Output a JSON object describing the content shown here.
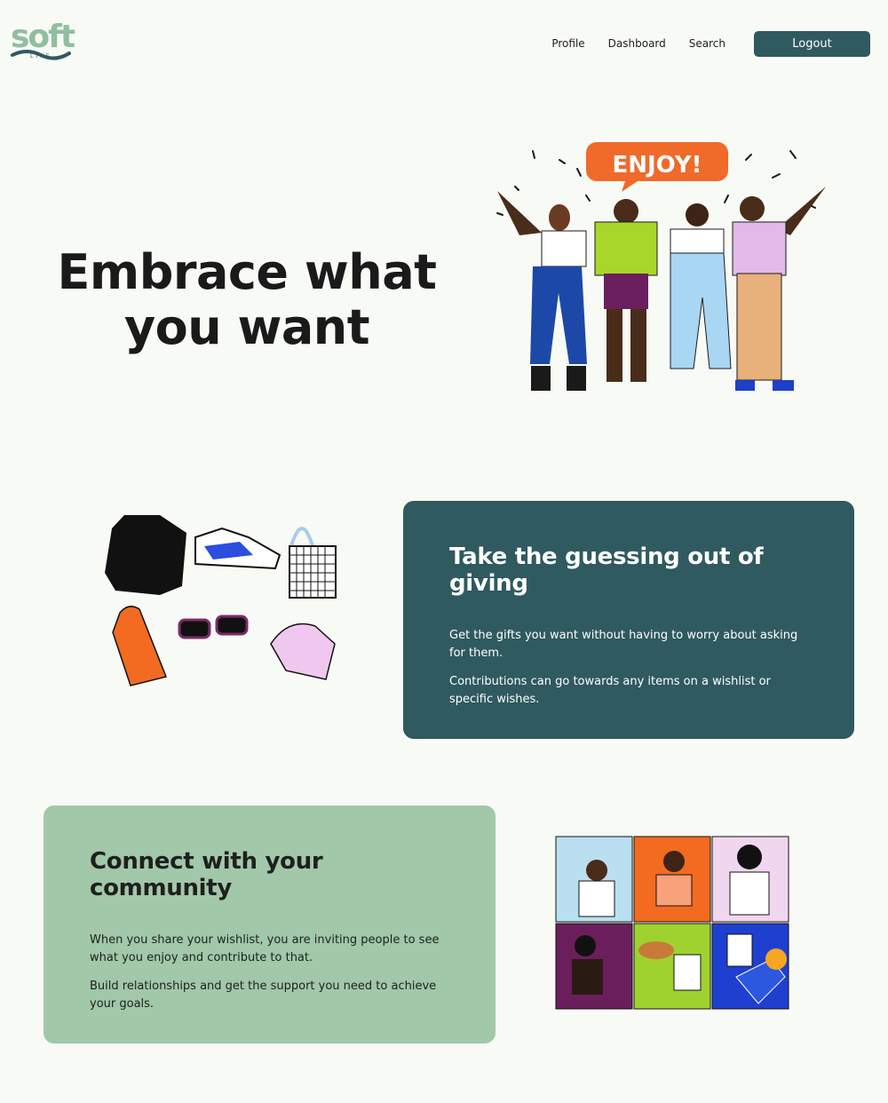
{
  "brand": {
    "logo_text": "soft",
    "logo_sub": "LIFE"
  },
  "nav": {
    "links": [
      "Profile",
      "Dashboard",
      "Search"
    ],
    "logout_label": "Logout"
  },
  "hero": {
    "title_line1": "Embrace what",
    "title_line2": "you want",
    "illustration_text": "ENJOY!"
  },
  "section_giving": {
    "title": "Take the guessing out of giving",
    "paragraph1": "Get the gifts you want without having to worry about asking for them.",
    "paragraph2": "Contributions can go towards any items on a wishlist or specific wishes."
  },
  "section_community": {
    "title": "Connect with your community",
    "paragraph1": "When you share your wishlist, you are inviting people to see what you enjoy and contribute to that.",
    "paragraph2": "Build relationships and get the support you need to achieve your goals."
  },
  "colors": {
    "background": "#f8faf5",
    "primary_dark": "#2f5a5f",
    "accent_green": "#a1c8a8",
    "logo_green": "#8fbfa0"
  },
  "icons": [
    "soft-life-logo",
    "people-celebrating-illustration",
    "gift-items-illustration",
    "community-grid-illustration"
  ]
}
